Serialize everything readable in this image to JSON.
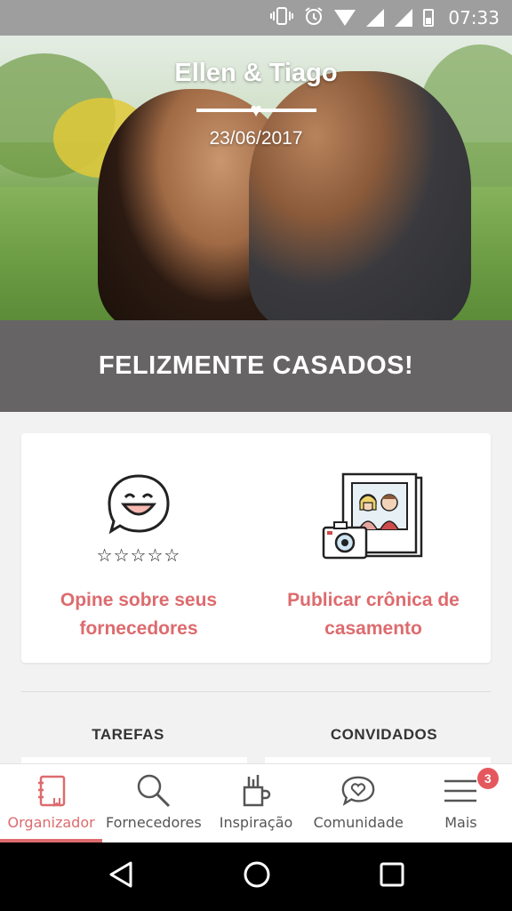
{
  "status_bar": {
    "time": "07:33",
    "icons": [
      "vibrate-icon",
      "alarm-icon",
      "wifi-icon",
      "signal-icon",
      "signal-icon",
      "battery-icon"
    ]
  },
  "hero": {
    "couple_names": "Ellen & Tiago",
    "date": "23/06/2017"
  },
  "banner": {
    "text": "FELIZMENTE CASADOS!"
  },
  "card": {
    "items": [
      {
        "label_line1": "Opine sobre seus",
        "label_line2": "fornecedores",
        "icon": "smiley-icon",
        "stars": "☆☆☆☆☆"
      },
      {
        "label_line1": "Publicar crônica de",
        "label_line2": "casamento",
        "icon": "photo-camera-icon"
      }
    ]
  },
  "sections": {
    "tasks": "TAREFAS",
    "guests": "CONVIDADOS"
  },
  "bottom_nav": {
    "items": [
      {
        "label": "Organizador",
        "icon": "notebook-icon",
        "active": true
      },
      {
        "label": "Fornecedores",
        "icon": "search-icon"
      },
      {
        "label": "Inspiração",
        "icon": "pencil-cup-icon"
      },
      {
        "label": "Comunidade",
        "icon": "chat-heart-icon"
      },
      {
        "label": "Mais",
        "icon": "menu-icon",
        "badge": "3"
      }
    ]
  },
  "colors": {
    "accent": "#dd6b6e",
    "banner": "#676466",
    "badge": "#e4585d"
  }
}
